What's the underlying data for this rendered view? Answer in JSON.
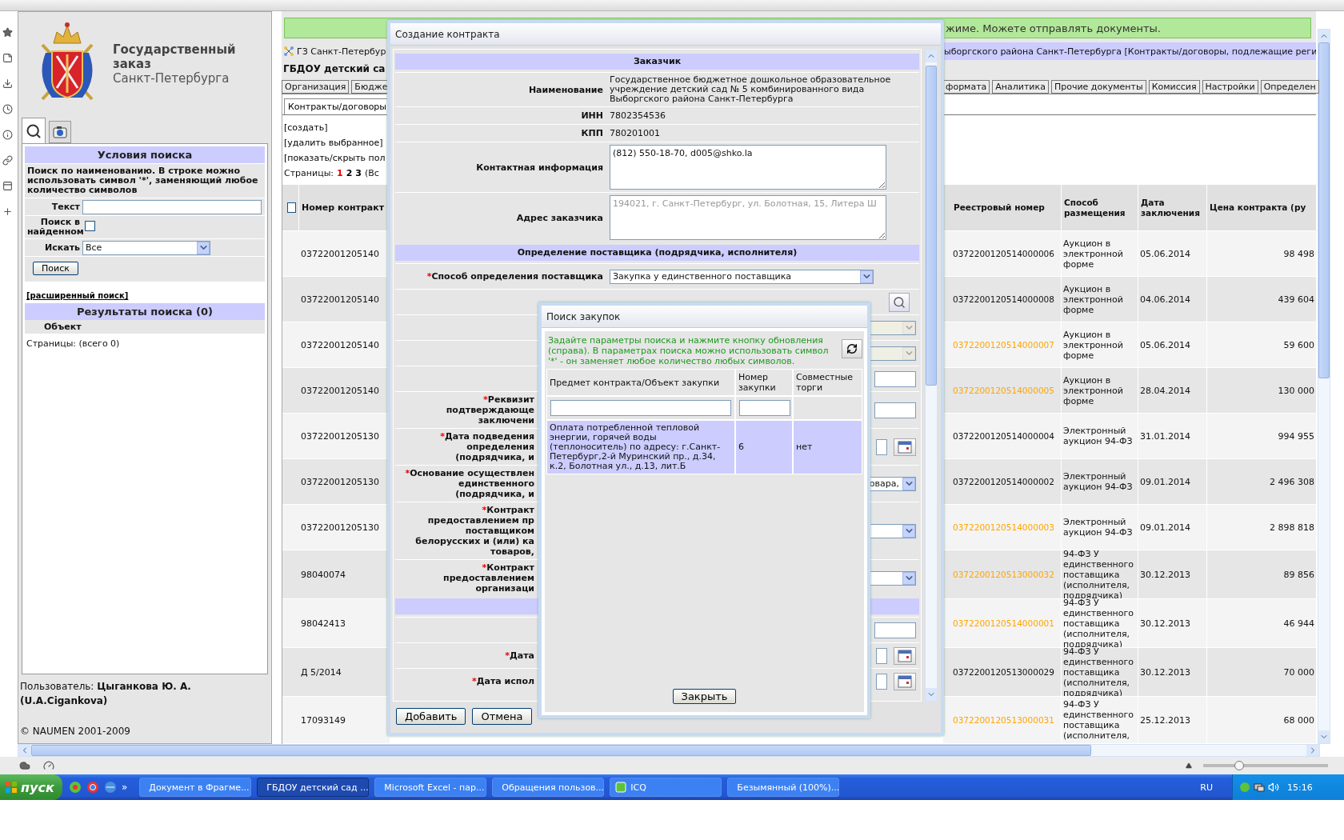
{
  "left_panel": {
    "logo_title": "Государственный заказ",
    "logo_subtitle": "Санкт-Петербурга",
    "tabs": [
      {
        "kind": "search",
        "selected": true
      },
      {
        "kind": "camera",
        "selected": false
      }
    ],
    "conditions": {
      "title": "Условия поиска",
      "hint": "Поиск по наименованию. В строке можно использовать символ '*', заменяющий любое количество символов",
      "text_label": "Текст",
      "in_found_label": "Поиск в найденном",
      "in_found_checked": false,
      "search_in_label": "Искать",
      "search_in_value": "Все",
      "button": "Поиск"
    },
    "advanced_link": "[расширенный поиск]",
    "results": {
      "title": "Результаты поиска (0)",
      "column": "Объект",
      "pages": "Страницы:  (всего 0)"
    },
    "user_line": "Пользователь: **Цыганкова Ю. А.**",
    "user_login": "(U.A.Cigankova)",
    "copyright": "© NAUMEN 2001-2009"
  },
  "main": {
    "banner": "жиме. Можете отправлять документы.",
    "breadcrumb_start": "ГЗ Санкт-Петербур",
    "breadcrumb_end": "ыборгского района Санкт-Петербурга [Контракты/договоры, подлежащие реги",
    "title": "ГБДОУ детский са",
    "tabs_before_dialog": [
      "Организация",
      "Бюдже"
    ],
    "tabs_after_dialog": [
      "формата",
      "Аналитика",
      "Прочие документы",
      "Комиссия",
      "Настройки",
      "Определен"
    ],
    "subtab": "Контракты/договоры",
    "actions": [
      "[создать]",
      "[удалить выбранное]",
      "[показать/скрыть пол"
    ],
    "pages": {
      "label": "Страницы:",
      "items": [
        {
          "label": "1",
          "selected": true
        },
        {
          "label": "2",
          "selected": false
        },
        {
          "label": "3",
          "selected": false
        }
      ],
      "rest": "(Вс"
    },
    "table": {
      "select_all_checked": false,
      "column_before_dialog": "Номер контракт",
      "columns_after_dialog": [
        "Реестровый номер",
        "Способ размещения",
        "Дата заключения",
        "Цена контракта (ру"
      ],
      "rows": [
        {
          "number": "03722001205140",
          "registry": "0372200120514000006",
          "highlighted": false,
          "method": "Аукцион в электронной форме",
          "date": "05.06.2014",
          "price": "98 498"
        },
        {
          "number": "03722001205140",
          "registry": "0372200120514000008",
          "highlighted": false,
          "method": "Аукцион в электронной форме",
          "date": "04.06.2014",
          "price": "439 604"
        },
        {
          "number": "03722001205140",
          "registry": "0372200120514000007",
          "highlighted": true,
          "method": "Аукцион в электронной форме",
          "date": "05.06.2014",
          "price": "59 600"
        },
        {
          "number": "03722001205140",
          "registry": "0372200120514000005",
          "highlighted": true,
          "method": "Аукцион в электронной форме",
          "date": "28.04.2014",
          "price": "130 000"
        },
        {
          "number": "03722001205130",
          "registry": "0372200120514000004",
          "highlighted": false,
          "method": "Электронный аукцион 94-ФЗ",
          "date": "31.01.2014",
          "price": "994 955"
        },
        {
          "number": "03722001205130",
          "registry": "0372200120514000002",
          "highlighted": false,
          "method": "Электронный аукцион 94-ФЗ",
          "date": "09.01.2014",
          "price": "2 496 308"
        },
        {
          "number": "03722001205130",
          "registry": "0372200120514000003",
          "highlighted": true,
          "method": "Электронный аукцион 94-ФЗ",
          "date": "09.01.2014",
          "price": "2 898 818"
        },
        {
          "number": "98040074",
          "registry": "0372200120513000032",
          "highlighted": true,
          "method": "94-ФЗ У единственного поставщика (исполнителя, подрядчика)",
          "date": "30.12.2013",
          "price": "89 856"
        },
        {
          "number": "98042413",
          "registry": "0372200120514000001",
          "highlighted": true,
          "method": "94-ФЗ У единственного поставщика (исполнителя, подрядчика)",
          "date": "30.12.2013",
          "price": "46 944"
        },
        {
          "number": "Д 5/2014",
          "registry": "0372200120513000029",
          "highlighted": false,
          "method": "94-ФЗ У единственного поставщика (исполнителя, подрядчика)",
          "date": "30.12.2013",
          "price": "70 000"
        },
        {
          "number": "17093149",
          "registry": "0372200120513000031",
          "highlighted": true,
          "method": "94-ФЗ У единственного поставщика (исполнителя,",
          "date": "25.12.2013",
          "price": "68 000"
        }
      ]
    }
  },
  "contract_dialog": {
    "title": "Создание контракта",
    "required_mark": "*",
    "customer_section": "Заказчик",
    "customer_fields": [
      {
        "kind": "text",
        "label": "Наименование",
        "value": "Государственное бюджетное дошкольное образовательное учреждение детский сад № 5 комбинированного вида Выборгского района Санкт-Петербурга"
      },
      {
        "kind": "text",
        "label": "ИНН",
        "value": "7802354536"
      },
      {
        "kind": "text",
        "label": "КПП",
        "value": "780201001"
      },
      {
        "kind": "textarea",
        "label": "Контактная информация",
        "value": "(812) 550-18-70, d005@shko.la",
        "disabled": false
      },
      {
        "kind": "textarea",
        "label": "Адрес заказчика",
        "value": "194021, г. Санкт-Петербург, ул. Болотная, 15, Литера Ш",
        "disabled": true
      }
    ],
    "supplier_section": "Определение поставщика (подрядчика, исполнителя)",
    "supplier_fields": [
      {
        "kind": "select",
        "label": "Способ определения поставщика",
        "required": true,
        "value": "Закупка у единственного поставщика"
      },
      {
        "kind": "search"
      },
      {
        "kind": "select",
        "disabled": true
      },
      {
        "kind": "select",
        "disabled": true
      },
      {
        "kind": "input"
      },
      {
        "kind": "input",
        "label": "Реквизит\nподтверждающе\nзаключени",
        "required": true
      },
      {
        "kind": "date",
        "label": "Дата подведения\nопределения\n(подрядчика, и",
        "required": true
      },
      {
        "kind": "select",
        "label": "Основание осуществлен\nединственного\n(подрядчика, и",
        "required": true,
        "value": "овара,"
      },
      {
        "kind": "select",
        "label": "Контракт\nпредоставлением пр\nпоставщиком\nбелорусских и (или) ка\nтоваров,",
        "required": true
      },
      {
        "kind": "select",
        "label": "Контракт\nпредоставлением\nорганизаци",
        "required": true
      },
      {
        "kind": "section"
      },
      {
        "kind": "input"
      },
      {
        "kind": "date",
        "label": "Дата",
        "required": true
      },
      {
        "kind": "date",
        "label": "Дата испол",
        "required": true
      }
    ],
    "buttons": [
      "Добавить",
      "Отмена"
    ]
  },
  "search_dialog": {
    "title": "Поиск закупок",
    "hint": "Задайте параметры поиска и нажмите кнопку обновления (справа). В параметрах поиска можно использовать символ '*' - он заменяет любое количество любых символов.",
    "columns": [
      "Предмет контракта/Объект закупки",
      "Номер закупки",
      "Совместные торги"
    ],
    "rows": [
      {
        "subject": "Оплата потребленной тепловой энергии, горячей воды (теплоноситель) по адресу: г.Санкт-Петербург,2-й Муринский пр., д.34, к.2, Болотная ул., д.13, лит.Б",
        "number": "6",
        "joint": "нет",
        "selected": true
      }
    ],
    "close": "Закрыть"
  },
  "status_strip": {
    "zoom_slider": {
      "level": 0.27
    }
  },
  "taskbar": {
    "start": "пуск",
    "more": "»",
    "tasks": [
      {
        "label": "Документ в Фрагме...",
        "selected": false
      },
      {
        "label": "ГБДОУ детский сад ...",
        "selected": true
      },
      {
        "label": "Microsoft Excel - пар...",
        "selected": false
      },
      {
        "label": "Обращения пользов...",
        "selected": false
      },
      {
        "label": "ICQ",
        "selected": false
      },
      {
        "label": "Безымянный (100%)...",
        "selected": false
      }
    ],
    "language": "RU",
    "clock": "15:16"
  }
}
